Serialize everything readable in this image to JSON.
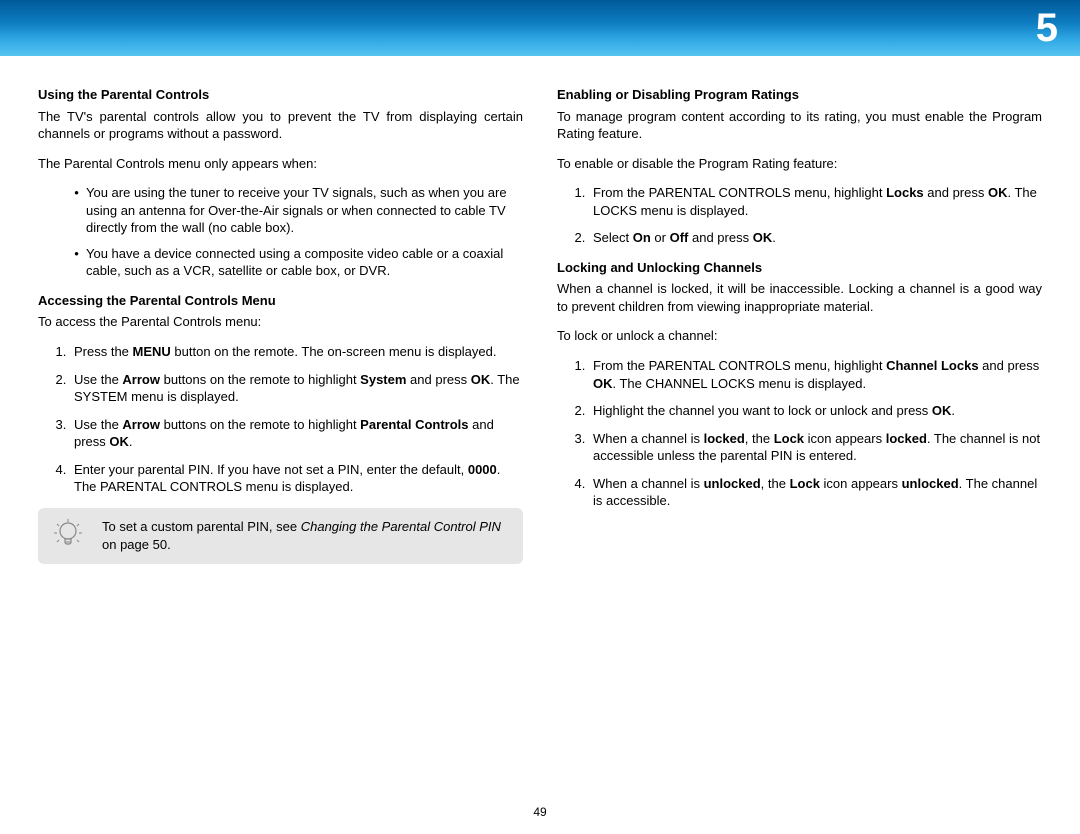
{
  "chapter_num": "5",
  "page_num": "49",
  "left": {
    "h1": "Using the Parental Controls",
    "p1": "The TV's parental controls allow you to prevent the TV from displaying certain channels or programs without a password.",
    "p2": "The Parental Controls menu only appears when:",
    "bullets": [
      "You are using the tuner to receive your TV signals, such as when you are using an antenna for Over-the-Air signals or when connected to cable TV directly from the wall (no cable box).",
      "You have a device connected using a composite video cable or a coaxial cable, such as a VCR, satellite or cable box, or DVR."
    ],
    "h2": "Accessing the Parental Controls Menu",
    "p3": "To access the Parental Controls menu:",
    "steps": {
      "s1a": "Press the ",
      "s1b": "MENU",
      "s1c": " button on the remote. The on-screen menu is displayed.",
      "s2a": "Use the ",
      "s2b": "Arrow",
      "s2c": " buttons on the remote to highlight ",
      "s2d": "System",
      "s2e": " and press ",
      "s2f": "OK",
      "s2g": ". The SYSTEM menu is displayed.",
      "s3a": "Use the ",
      "s3b": "Arrow",
      "s3c": " buttons on the remote to highlight ",
      "s3d": "Parental Controls",
      "s3e": " and press ",
      "s3f": "OK",
      "s3g": ".",
      "s4a": "Enter your parental PIN. If you have not set a PIN, enter the default, ",
      "s4b": "0000",
      "s4c": ". The PARENTAL CONTROLS menu is displayed."
    },
    "tip": {
      "t1": "To set a custom parental PIN, see ",
      "t2": "Changing the Parental Control PIN",
      "t3": " on page 50."
    }
  },
  "right": {
    "h1": "Enabling or Disabling Program Ratings",
    "p1": "To manage program content according to its rating, you must enable the Program Rating feature.",
    "p2": "To enable or disable the Program Rating feature:",
    "stepsA": {
      "s1a": "From the PARENTAL CONTROLS menu, highlight ",
      "s1b": "Locks",
      "s1c": " and press ",
      "s1d": "OK",
      "s1e": ". The LOCKS menu is displayed.",
      "s2a": "Select ",
      "s2b": "On",
      "s2c": " or ",
      "s2d": "Off",
      "s2e": " and press ",
      "s2f": "OK",
      "s2g": "."
    },
    "h2": "Locking and Unlocking Channels",
    "p3": "When a channel is locked, it will be inaccessible. Locking a channel is a good way to prevent children from viewing inappropriate material.",
    "p4": "To lock or unlock a channel:",
    "stepsB": {
      "s1a": "From the PARENTAL CONTROLS menu, highlight ",
      "s1b": "Channel Locks",
      "s1c": " and press ",
      "s1d": "OK",
      "s1e": ". The CHANNEL LOCKS menu is displayed.",
      "s2a": "Highlight the channel you want to lock or unlock and press ",
      "s2b": "OK",
      "s2c": ".",
      "s3a": "When a channel is ",
      "s3b": "locked",
      "s3c": ", the ",
      "s3d": "Lock",
      "s3e": " icon appears ",
      "s3f": "locked",
      "s3g": ". The channel is not accessible unless the parental PIN is entered.",
      "s4a": "When a channel is ",
      "s4b": "unlocked",
      "s4c": ", the ",
      "s4d": "Lock",
      "s4e": " icon appears ",
      "s4f": "unlocked",
      "s4g": ". The channel is accessible."
    }
  }
}
